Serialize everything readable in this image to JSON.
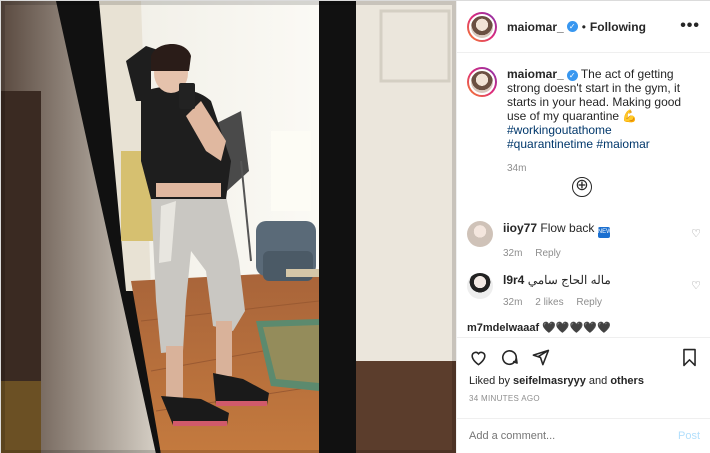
{
  "header": {
    "username": "maiomar_",
    "verified_mark": "✓",
    "separator": "•",
    "follow_status": "Following",
    "more_icon": "more-dots-icon",
    "more_label": "•••"
  },
  "caption": {
    "username": "maiomar_",
    "text": "The act of getting strong doesn't start in the gym, it starts in your head. Making good use of my quarantine",
    "emoji": "💪",
    "hashtags": [
      "#workingoutathome",
      "#quarantinetime",
      "#maiomar"
    ],
    "time": "34m"
  },
  "load_more": "⊕",
  "comments": [
    {
      "username": "iioy77",
      "text": "Flow back",
      "badge": "NEW",
      "time": "32m",
      "likes": "",
      "reply": "Reply"
    },
    {
      "username": "l9r4",
      "text": "ماله الحاج سامي",
      "time": "32m",
      "likes": "2 likes",
      "reply": "Reply"
    }
  ],
  "partial_comment": "m7mdelwaaaf 🖤🖤🖤🖤🖤",
  "actions": {
    "liked_by_prefix": "Liked by",
    "liked_by_user": "seifelmasryyy",
    "liked_by_and": "and",
    "liked_by_others": "others",
    "posted_ago": "34 MINUTES AGO"
  },
  "add_comment": {
    "placeholder": "Add a comment...",
    "post_label": "Post"
  },
  "colors": {
    "link": "#00376b",
    "verified": "#3897f0",
    "muted": "#8e8e8e",
    "post_disabled": "#b2dffc"
  }
}
